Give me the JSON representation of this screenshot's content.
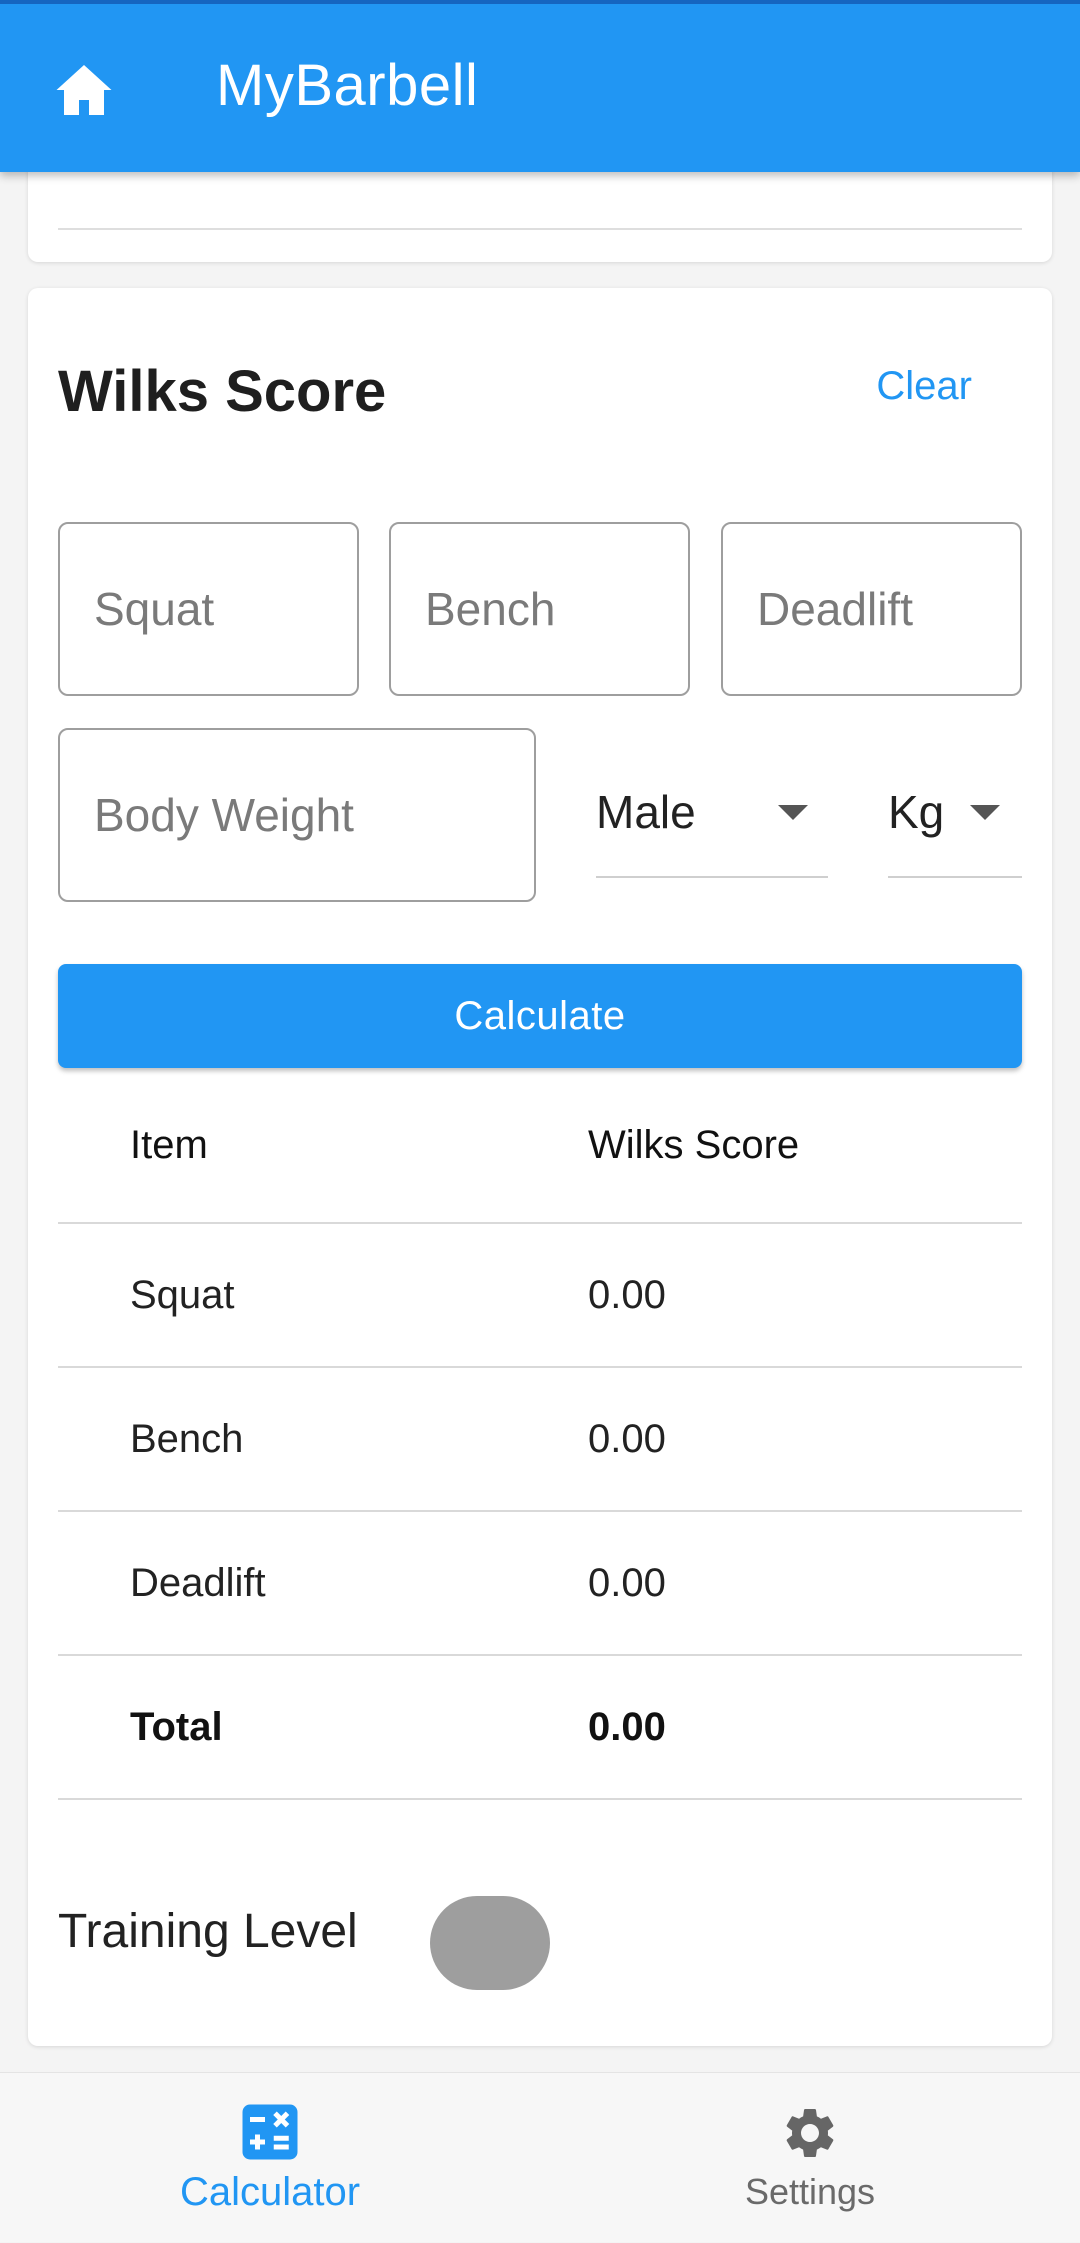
{
  "app_bar": {
    "title": "MyBarbell",
    "home_icon": "home-icon",
    "color": "#2196f3"
  },
  "wilks": {
    "title": "Wilks Score",
    "clear_label": "Clear",
    "inputs": {
      "squat_placeholder": "Squat",
      "bench_placeholder": "Bench",
      "deadlift_placeholder": "Deadlift",
      "body_weight_placeholder": "Body Weight"
    },
    "gender_selected": "Male",
    "unit_selected": "Kg",
    "calculate_label": "Calculate"
  },
  "results": {
    "headers": [
      "Item",
      "Wilks Score"
    ],
    "rows": [
      {
        "item": "Squat",
        "score": "0.00"
      },
      {
        "item": "Bench",
        "score": "0.00"
      },
      {
        "item": "Deadlift",
        "score": "0.00"
      }
    ],
    "total": {
      "item": "Total",
      "score": "0.00"
    }
  },
  "training": {
    "label": "Training Level",
    "toggle_on": false
  },
  "bottom_nav": {
    "items": [
      {
        "label": "Calculator",
        "icon": "calculator-icon",
        "active": true
      },
      {
        "label": "Settings",
        "icon": "gear-icon",
        "active": false
      }
    ]
  },
  "colors": {
    "accent": "#2196f3",
    "toggle_off": "#9e9e9e"
  }
}
